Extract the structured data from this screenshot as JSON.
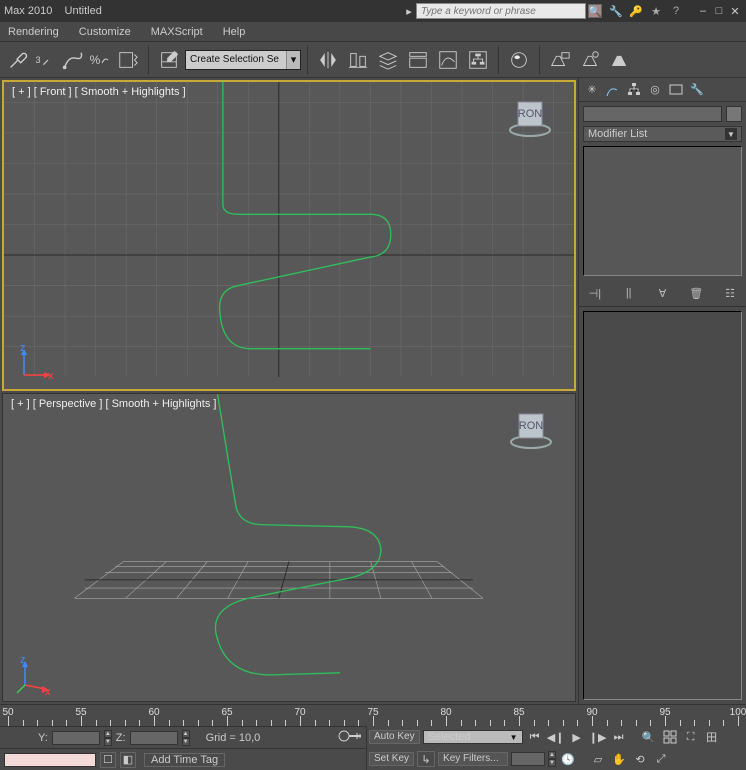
{
  "title": {
    "app": "Max 2010",
    "doc": "Untitled"
  },
  "search": {
    "placeholder": "Type a keyword or phrase"
  },
  "menu": {
    "rendering": "Rendering",
    "customize": "Customize",
    "maxscript": "MAXScript",
    "help": "Help"
  },
  "toolbar": {
    "selection_set": "Create Selection Se",
    "link_sub": "3"
  },
  "viewports": {
    "front": {
      "label": "[ + ] [ Front ] [ Smooth + Highlights ]",
      "cube_face": "FRONT"
    },
    "persp": {
      "label": "[ + ] [ Perspective ] [ Smooth + Highlights ]",
      "cube_face": "FRONT"
    }
  },
  "sidepanel": {
    "modifier_list_label": "Modifier List"
  },
  "timeline": {
    "major_ticks": [
      "50",
      "55",
      "60",
      "65",
      "70",
      "75",
      "80",
      "85",
      "90",
      "95",
      "100"
    ]
  },
  "status": {
    "y_label": "Y:",
    "z_label": "Z:",
    "grid_readout": "Grid = 10,0",
    "add_time_tag": "Add Time Tag",
    "auto_key": "Auto Key",
    "set_key": "Set Key",
    "selected": "Selected",
    "key_filters": "Key Filters..."
  }
}
